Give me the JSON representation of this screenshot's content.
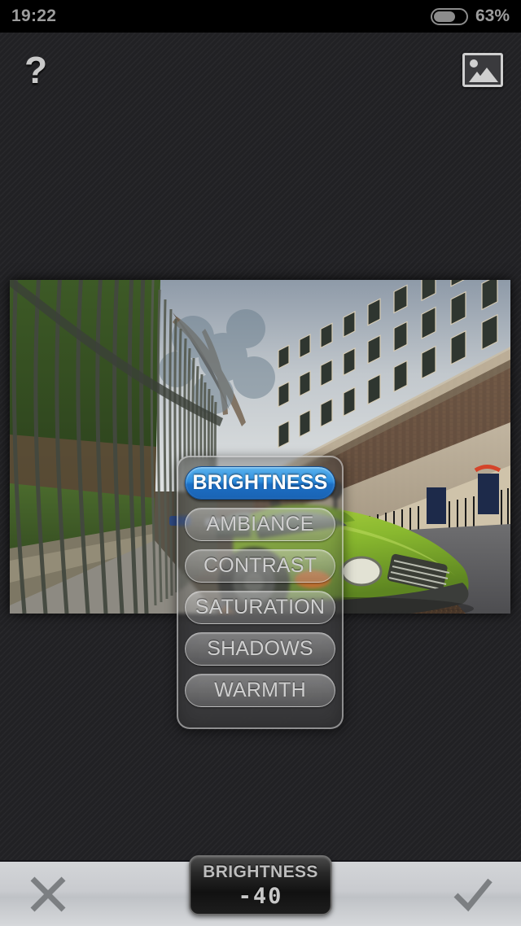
{
  "status_bar": {
    "time": "19:22",
    "battery_percent": "63%",
    "battery_level": 63,
    "battery_icon": "battery-icon"
  },
  "toolbar": {
    "help_icon": "question-mark-icon",
    "help_label": "?",
    "gallery_icon": "photo-gallery-icon"
  },
  "photo": {
    "alt": "street scene with iron fence, Georgian terrace buildings and a green vintage car"
  },
  "menu": {
    "items": [
      {
        "label": "BRIGHTNESS",
        "selected": true
      },
      {
        "label": "AMBIANCE",
        "selected": false
      },
      {
        "label": "CONTRAST",
        "selected": false
      },
      {
        "label": "SATURATION",
        "selected": false
      },
      {
        "label": "SHADOWS",
        "selected": false
      },
      {
        "label": "WARMTH",
        "selected": false
      }
    ]
  },
  "bottom_bar": {
    "cancel_icon": "close-x-icon",
    "confirm_icon": "checkmark-icon",
    "readout": {
      "label": "BRIGHTNESS",
      "value": "-40"
    }
  },
  "colors": {
    "accent_blue": "#2e8ede",
    "background": "#232326",
    "status_text": "#9d9d9d",
    "bottom_bar": "#c9cbcf"
  }
}
